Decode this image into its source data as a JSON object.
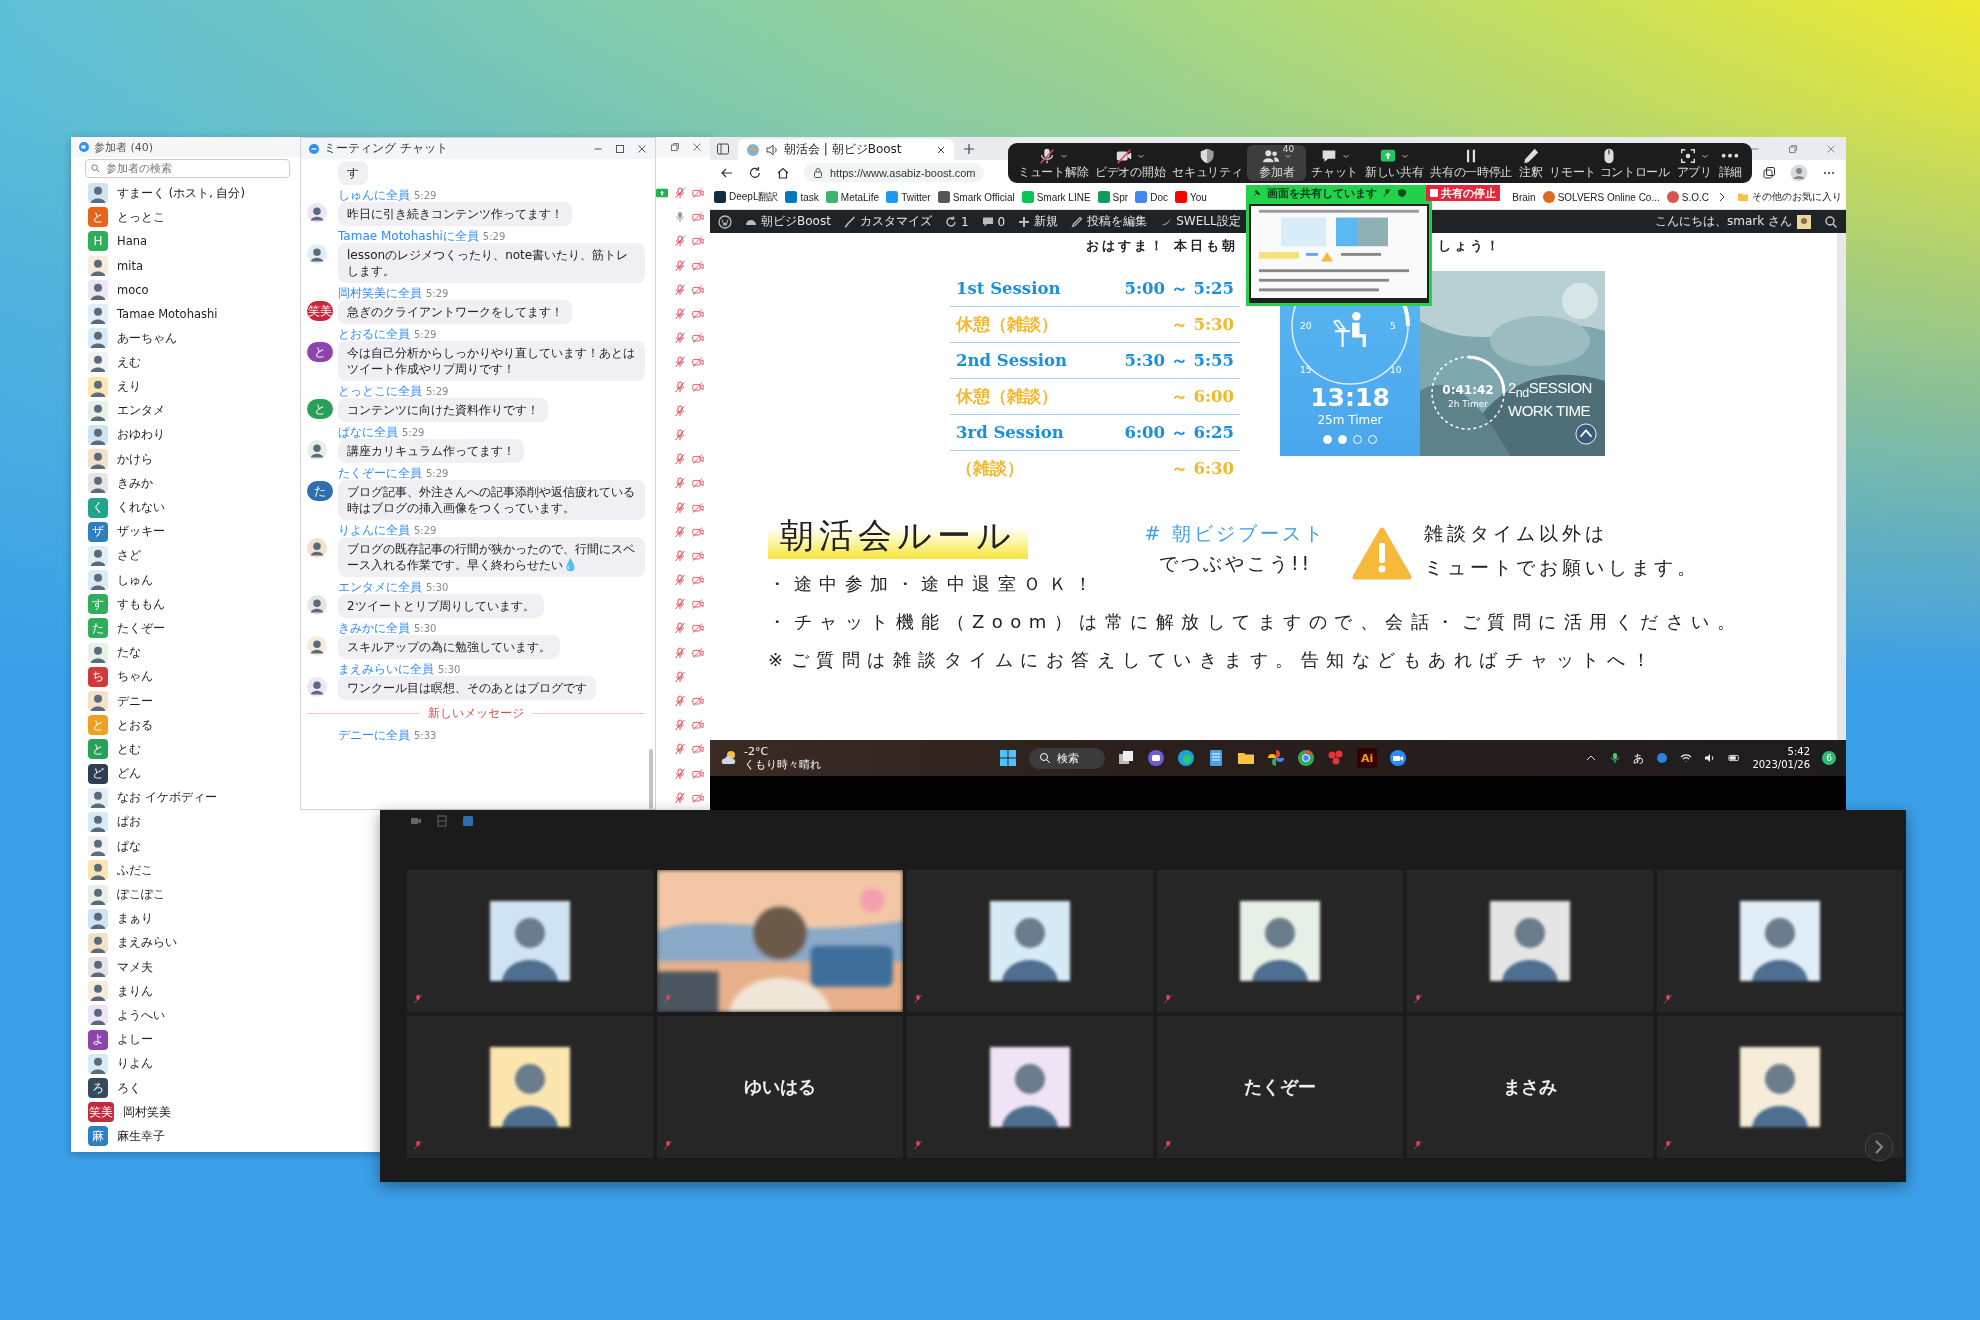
{
  "participants_window": {
    "title": "参加者 (40)",
    "search": {
      "placeholder": "参加者の検索"
    },
    "participants": [
      {
        "name": "すまーく (ホスト, 自分)",
        "avatar": {
          "kind": "picture"
        },
        "sharing": true,
        "muted": true,
        "video_off": true
      },
      {
        "name": "とっとこ",
        "avatar": {
          "kind": "letter",
          "text": "と",
          "color": "#e8641b"
        },
        "sharing": false,
        "muted": false,
        "video_off": true
      },
      {
        "name": "Hana",
        "avatar": {
          "kind": "letter",
          "text": "H",
          "color": "#2ead5a"
        },
        "sharing": false,
        "muted": true,
        "video_off": true
      },
      {
        "name": "mita",
        "avatar": {
          "kind": "picture"
        },
        "sharing": false,
        "muted": true,
        "video_off": true
      },
      {
        "name": "moco",
        "avatar": {
          "kind": "picture"
        },
        "sharing": false,
        "muted": true,
        "video_off": true
      },
      {
        "name": "Tamae Motohashi",
        "avatar": {
          "kind": "picture"
        },
        "sharing": false,
        "muted": true,
        "video_off": true
      },
      {
        "name": "あーちゃん",
        "avatar": {
          "kind": "picture"
        },
        "sharing": false,
        "muted": true,
        "video_off": true
      },
      {
        "name": "えむ",
        "avatar": {
          "kind": "picture"
        },
        "sharing": false,
        "muted": true,
        "video_off": true
      },
      {
        "name": "えり",
        "avatar": {
          "kind": "picture"
        },
        "sharing": false,
        "muted": true,
        "video_off": true
      },
      {
        "name": "エンタメ",
        "avatar": {
          "kind": "picture"
        },
        "sharing": false,
        "muted": true,
        "video_off": false
      },
      {
        "name": "おゆわり",
        "avatar": {
          "kind": "picture"
        },
        "sharing": false,
        "muted": true,
        "video_off": false
      },
      {
        "name": "かけら",
        "avatar": {
          "kind": "picture"
        },
        "sharing": false,
        "muted": true,
        "video_off": true
      },
      {
        "name": "きみか",
        "avatar": {
          "kind": "picture"
        },
        "sharing": false,
        "muted": true,
        "video_off": true
      },
      {
        "name": "くれない",
        "avatar": {
          "kind": "letter",
          "text": "く",
          "color": "#1fa58a"
        },
        "sharing": false,
        "muted": true,
        "video_off": true
      },
      {
        "name": "ザッキー",
        "avatar": {
          "kind": "letter",
          "text": "ザ",
          "color": "#2d7fc1"
        },
        "sharing": false,
        "muted": true,
        "video_off": true
      },
      {
        "name": "さど",
        "avatar": {
          "kind": "picture"
        },
        "sharing": false,
        "muted": true,
        "video_off": true
      },
      {
        "name": "しゅん",
        "avatar": {
          "kind": "picture"
        },
        "sharing": false,
        "muted": true,
        "video_off": true
      },
      {
        "name": "すももん",
        "avatar": {
          "kind": "letter",
          "text": "す",
          "color": "#2ead5a"
        },
        "sharing": false,
        "muted": true,
        "video_off": true
      },
      {
        "name": "たくぞー",
        "avatar": {
          "kind": "letter",
          "text": "た",
          "color": "#2ead5a"
        },
        "sharing": false,
        "muted": true,
        "video_off": true
      },
      {
        "name": "たな",
        "avatar": {
          "kind": "picture"
        },
        "sharing": false,
        "muted": true,
        "video_off": true
      },
      {
        "name": "ちゃん",
        "avatar": {
          "kind": "letter",
          "text": "ち",
          "color": "#d03a3a"
        },
        "sharing": false,
        "muted": true,
        "video_off": false
      },
      {
        "name": "デニー",
        "avatar": {
          "kind": "picture"
        },
        "sharing": false,
        "muted": true,
        "video_off": true
      },
      {
        "name": "とおる",
        "avatar": {
          "kind": "letter",
          "text": "と",
          "color": "#f0a020"
        },
        "sharing": false,
        "muted": true,
        "video_off": true
      },
      {
        "name": "とむ",
        "avatar": {
          "kind": "letter",
          "text": "と",
          "color": "#27a05a"
        },
        "sharing": false,
        "muted": true,
        "video_off": true
      },
      {
        "name": "どん",
        "avatar": {
          "kind": "letter",
          "text": "ど",
          "color": "#2c3e50"
        },
        "sharing": false,
        "muted": true,
        "video_off": true
      },
      {
        "name": "なお イケボディー",
        "avatar": {
          "kind": "picture"
        },
        "sharing": false,
        "muted": true,
        "video_off": true
      },
      {
        "name": "ぱお",
        "avatar": {
          "kind": "picture"
        }
      },
      {
        "name": "ぱな",
        "avatar": {
          "kind": "picture"
        }
      },
      {
        "name": "ふだこ",
        "avatar": {
          "kind": "picture"
        }
      },
      {
        "name": "ぽこぽこ",
        "avatar": {
          "kind": "picture"
        }
      },
      {
        "name": "まぁり",
        "avatar": {
          "kind": "picture"
        }
      },
      {
        "name": "まえみらい",
        "avatar": {
          "kind": "picture"
        }
      },
      {
        "name": "マメ夫",
        "avatar": {
          "kind": "picture"
        }
      },
      {
        "name": "まりん",
        "avatar": {
          "kind": "picture"
        }
      },
      {
        "name": "ようへい",
        "avatar": {
          "kind": "picture"
        }
      },
      {
        "name": "よしー",
        "avatar": {
          "kind": "letter",
          "text": "よ",
          "color": "#8e44ad"
        }
      },
      {
        "name": "りよん",
        "avatar": {
          "kind": "picture"
        }
      },
      {
        "name": "ろく",
        "avatar": {
          "kind": "letter",
          "text": "ろ",
          "color": "#34495e"
        }
      },
      {
        "name": "岡村笑美",
        "avatar": {
          "kind": "letter",
          "text": "笑美",
          "color": "#c8283c"
        }
      },
      {
        "name": "麻生幸子",
        "avatar": {
          "kind": "letter",
          "text": "麻",
          "color": "#2d7fc1"
        }
      }
    ]
  },
  "chat_window": {
    "title": "ミーティング チャット",
    "messages": [
      {
        "kind": "message",
        "text": "す"
      },
      {
        "kind": "message",
        "sender": "しゅんに全員",
        "time": "5:29",
        "avatar": {
          "kind": "picture"
        },
        "text": "昨日に引き続きコンテンツ作ってます！"
      },
      {
        "kind": "message",
        "sender": "Tamae Motohashiに全員",
        "time": "5:29",
        "avatar": {
          "kind": "picture"
        },
        "text": "lessonのレジメつくったり、note書いたり、筋トレします。"
      },
      {
        "kind": "message",
        "sender": "岡村笑美に全員",
        "time": "5:29",
        "avatar": {
          "kind": "letter",
          "text": "笑美",
          "color": "#c8283c"
        },
        "text": "急ぎのクライアントワークをしてます！"
      },
      {
        "kind": "message",
        "sender": "とおるに全員",
        "time": "5:29",
        "avatar": {
          "kind": "letter",
          "text": "と",
          "color": "#8e44ad"
        },
        "text": "今は自己分析からしっかりやり直しています！あとはツイート作成やリプ周りです！"
      },
      {
        "kind": "message",
        "sender": "とっとこに全員",
        "time": "5:29",
        "avatar": {
          "kind": "letter",
          "text": "と",
          "color": "#27a05a"
        },
        "text": "コンテンツに向けた資料作りです！"
      },
      {
        "kind": "message",
        "sender": "ぱなに全員",
        "time": "5:29",
        "avatar": {
          "kind": "picture"
        },
        "text": "講座カリキュラム作ってます！"
      },
      {
        "kind": "message",
        "sender": "たくぞーに全員",
        "time": "5:29",
        "avatar": {
          "kind": "letter",
          "text": "た",
          "color": "#2d6fb0"
        },
        "text": "ブログ記事、外注さんへの記事添削や返信疲れている時はブログの挿入画像をつくっています。"
      },
      {
        "kind": "message",
        "sender": "りよんに全員",
        "time": "5:29",
        "avatar": {
          "kind": "picture"
        },
        "text": "ブログの既存記事の行間が狭かったので、行間にスペース入れる作業です。早く終わらせたい💧"
      },
      {
        "kind": "message",
        "sender": "エンタメに全員",
        "time": "5:30",
        "avatar": {
          "kind": "picture"
        },
        "text": "2ツイートとリプ周りしています。"
      },
      {
        "kind": "message",
        "sender": "きみかに全員",
        "time": "5:30",
        "avatar": {
          "kind": "picture"
        },
        "text": "スキルアップの為に勉強しています。"
      },
      {
        "kind": "message",
        "sender": "まえみらいに全員",
        "time": "5:30",
        "avatar": {
          "kind": "picture"
        },
        "text": "ワンクール目は瞑想、そのあとはブログです"
      },
      {
        "kind": "divider",
        "text": "新しいメッセージ"
      },
      {
        "kind": "message",
        "sender": "デニーに全員",
        "time": "5:33"
      }
    ]
  },
  "browser": {
    "tab": {
      "title": "朝活会 | 朝ビジBoost"
    },
    "url": "https://www.asabiz-boost.com",
    "bookmarks": [
      {
        "label": "DeepL翻訳",
        "color": "#0f2b46"
      },
      {
        "label": "task",
        "color": "#0079bf"
      },
      {
        "label": "MetaLife",
        "color": "#3cb371"
      },
      {
        "label": "Twitter",
        "color": "#1d9bf0"
      },
      {
        "label": "Smark Official",
        "color": "#555555"
      },
      {
        "label": "Smark LINE",
        "color": "#06c755"
      },
      {
        "label": "Spr",
        "color": "#0f9d58"
      },
      {
        "label": "Doc",
        "color": "#4285f4"
      },
      {
        "label": "You",
        "color": "#ff0000"
      }
    ],
    "bookmarks_right": [
      {
        "label": "Brain"
      },
      {
        "label": "SOLVERS Online Co...",
        "color": "#e06a1b"
      },
      {
        "label": "S.O.C",
        "color": "#d9534f"
      }
    ],
    "other_bookmarks": "その他のお気に入り",
    "admin_bar": {
      "items": [
        {
          "kind": "wp"
        },
        {
          "kind": "home",
          "label": "朝ビジBoost"
        },
        {
          "kind": "brush",
          "label": "カスタマイズ"
        },
        {
          "kind": "update",
          "label": "1"
        },
        {
          "kind": "comment",
          "label": "0"
        },
        {
          "kind": "plus",
          "label": "新規"
        },
        {
          "kind": "pencil",
          "label": "投稿を編集"
        },
        {
          "kind": "swell",
          "label": "SWELL設定"
        }
      ],
      "greeting": "こんにちは、smark さん"
    },
    "slide": {
      "greeting_left": "おはすま！ 本日も朝",
      "greeting_right": "しょう！",
      "schedule": [
        {
          "kind": "session",
          "label": "1st Session",
          "time": "5:00 ～ 5:25"
        },
        {
          "kind": "break",
          "label": "休憩（雑談）",
          "time": "～ 5:30"
        },
        {
          "kind": "session",
          "label": "2nd Session",
          "time": "5:30 ～ 5:55"
        },
        {
          "kind": "break",
          "label": "休憩（雑談）",
          "time": "～ 6:00"
        },
        {
          "kind": "session",
          "label": "3rd Session",
          "time": "6:00 ～ 6:25"
        },
        {
          "kind": "break",
          "label": "（雑談）",
          "time": "～ 6:30"
        }
      ],
      "timer": {
        "dial": [
          "20",
          "5",
          "15",
          "10"
        ],
        "time": "13:18",
        "label": "25m Timer",
        "pages": [
          {
            "selected": true
          },
          {
            "selected": true
          },
          {
            "selected": false
          },
          {
            "selected": false
          }
        ]
      },
      "session_timer": {
        "time": "0:41:42",
        "label": "2h Timer",
        "title": "2$_{nd}$SESSION",
        "subtitle": "WORK TIME"
      },
      "rules": {
        "title": "朝活会ルール",
        "hashtag": "# 朝ビジブースト",
        "hashtag_note": "でつぶやこう!!",
        "notice": [
          "雑談タイム以外は",
          "ミュートでお願いします。"
        ],
        "bullets": [
          "・途中参加・途中退室ＯＫ！",
          "・チャット機能（Zoom）は常に解放してますので、会話・ご質問に活用ください。",
          "※ご質問は雑談タイムにお答えしていきます。告知などもあればチャットへ！"
        ]
      }
    },
    "taskbar": {
      "temperature": "-2°C",
      "weather": "くもり時々晴れ",
      "search": "検索",
      "ai_app": "Ai",
      "ime": "あ",
      "time": "5:42",
      "date": "2023/01/26",
      "notifications": "6"
    }
  },
  "zoom_toolbar": {
    "items": [
      {
        "kind": "mic-off",
        "label": "ミュート解除",
        "caret": true,
        "selected": false
      },
      {
        "kind": "video-off",
        "label": "ビデオの開始",
        "caret": true,
        "selected": false
      },
      {
        "kind": "shield",
        "label": "セキュリティ",
        "caret": false,
        "selected": false
      },
      {
        "kind": "people",
        "label": "参加者",
        "badge": "40",
        "caret": true,
        "selected": true
      },
      {
        "kind": "chat",
        "label": "チャット",
        "caret": true,
        "selected": false
      },
      {
        "kind": "share",
        "label": "新しい共有",
        "caret": true,
        "selected": false
      },
      {
        "kind": "pause",
        "label": "共有の一時停止",
        "caret": false,
        "selected": false
      },
      {
        "kind": "pen",
        "label": "注釈",
        "caret": false,
        "selected": false
      },
      {
        "kind": "mouse",
        "label": "リモート コントロール",
        "caret": false,
        "selected": false
      },
      {
        "kind": "apps",
        "label": "アプリ",
        "caret": true,
        "selected": false
      },
      {
        "kind": "more",
        "label": "詳細",
        "caret": false,
        "selected": false
      }
    ],
    "share_banner": "画面を共有しています",
    "stop_share": "共有の停止"
  },
  "video_window": {
    "tiles": [
      {
        "kind": "picture",
        "muted": true
      },
      {
        "kind": "video",
        "muted": true
      },
      {
        "kind": "picture",
        "muted": true
      },
      {
        "kind": "picture",
        "muted": true
      },
      {
        "kind": "picture",
        "muted": true
      },
      {
        "kind": "picture",
        "muted": true
      },
      {
        "kind": "picture",
        "muted": true
      },
      {
        "kind": "name",
        "name": "ゆいはる",
        "muted": true
      },
      {
        "kind": "picture",
        "muted": true
      },
      {
        "kind": "name",
        "name": "たくぞー",
        "muted": true
      },
      {
        "kind": "name",
        "name": "まさみ",
        "muted": true
      },
      {
        "kind": "picture",
        "muted": true
      }
    ]
  }
}
